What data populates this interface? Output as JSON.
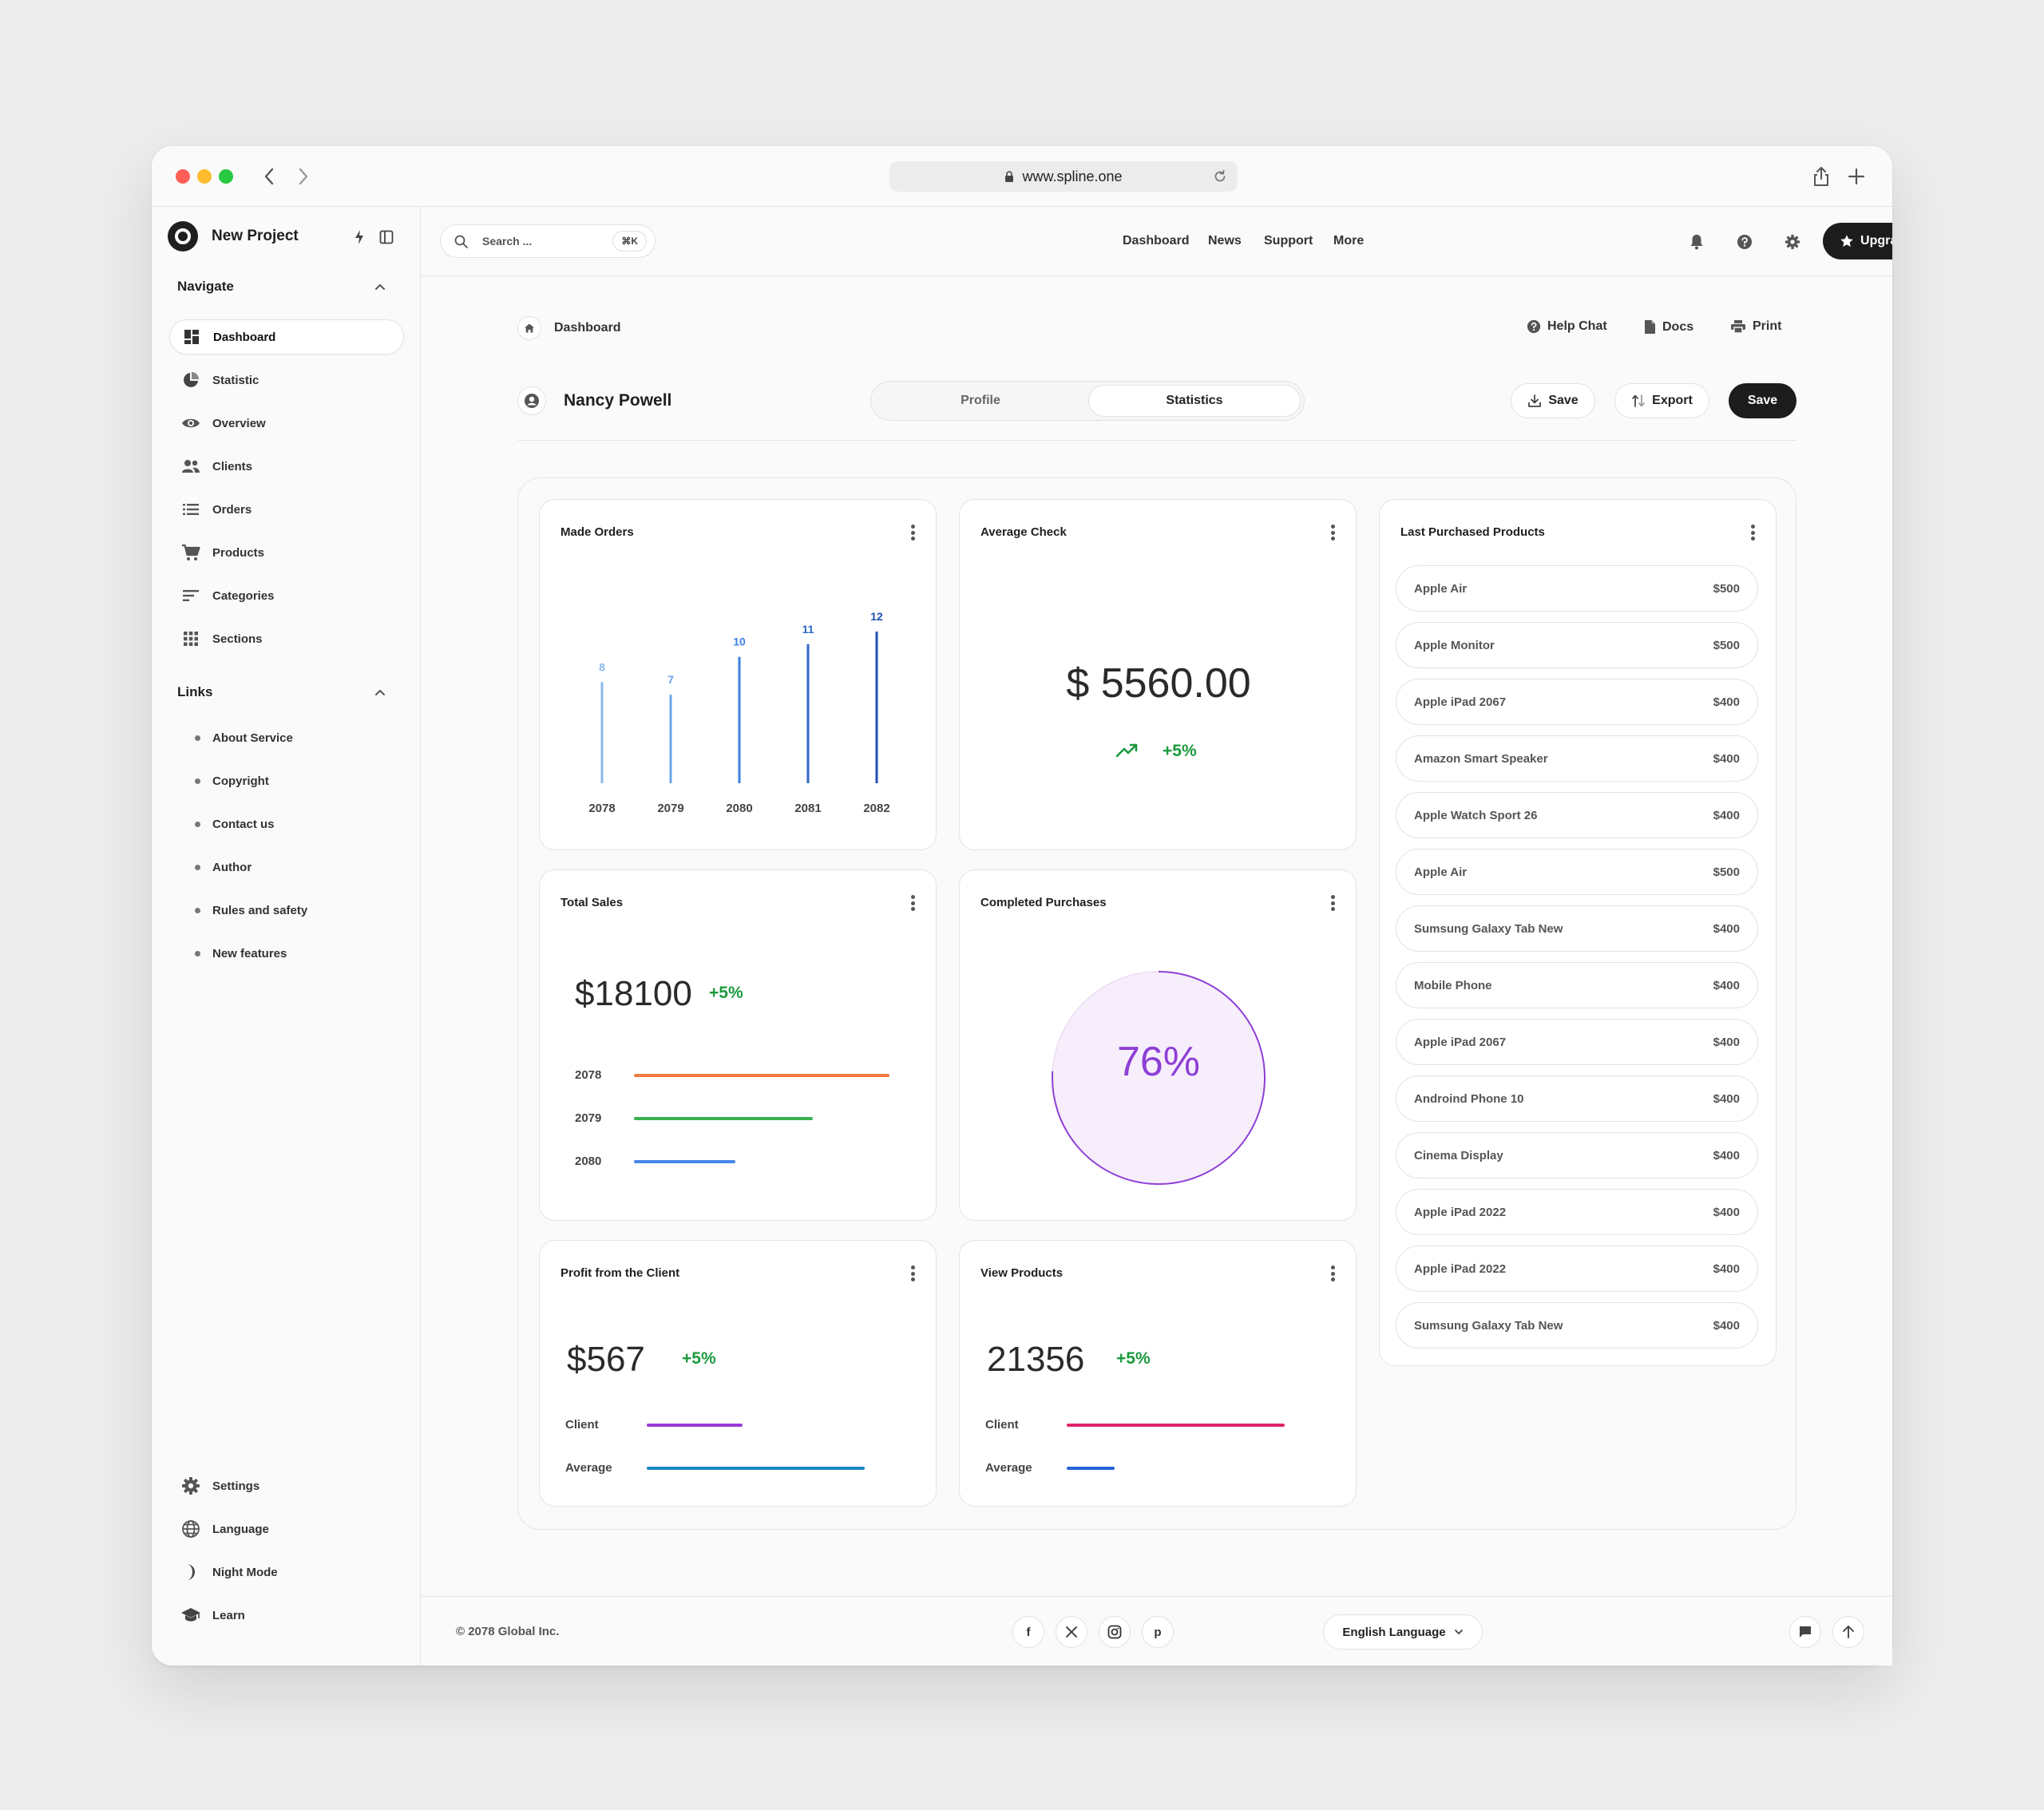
{
  "browser": {
    "url": "www.spline.one",
    "traffic_colors": [
      "#ff5f57",
      "#febc2e",
      "#28c840"
    ]
  },
  "sidebar": {
    "project_name": "New Project",
    "navigate_title": "Navigate",
    "nav_items": [
      {
        "label": "Dashboard",
        "icon": "dashboard-icon",
        "active": true
      },
      {
        "label": "Statistic",
        "icon": "pie-chart-icon"
      },
      {
        "label": "Overview",
        "icon": "eye-icon"
      },
      {
        "label": "Clients",
        "icon": "users-icon"
      },
      {
        "label": "Orders",
        "icon": "list-icon"
      },
      {
        "label": "Products",
        "icon": "cart-icon"
      },
      {
        "label": "Categories",
        "icon": "sort-icon"
      },
      {
        "label": "Sections",
        "icon": "grid-icon"
      }
    ],
    "links_title": "Links",
    "links": [
      "About Service",
      "Copyright",
      "Contact us",
      "Author",
      "Rules and safety",
      "New features"
    ],
    "bottom_items": [
      {
        "label": "Settings",
        "icon": "gear-icon"
      },
      {
        "label": "Language",
        "icon": "globe-icon"
      },
      {
        "label": "Night Mode",
        "icon": "moon-icon"
      },
      {
        "label": "Learn",
        "icon": "graduation-cap-icon"
      }
    ]
  },
  "header": {
    "search_placeholder": "Search ...",
    "search_shortcut": "⌘K",
    "nav": [
      "Dashboard",
      "News",
      "Support",
      "More"
    ],
    "upgrade_label": "Upgrade"
  },
  "breadcrumb": {
    "current": "Dashboard"
  },
  "utility_links": [
    "Help Chat",
    "Docs",
    "Print"
  ],
  "profile": {
    "name": "Nancy Powell",
    "tabs": [
      {
        "label": "Profile"
      },
      {
        "label": "Statistics",
        "active": true
      }
    ],
    "save_outline_label": "Save",
    "export_label": "Export",
    "save_label": "Save"
  },
  "cards": {
    "made_orders": {
      "title": "Made Orders"
    },
    "average_check": {
      "title": "Average Check",
      "value": "$ 5560.00",
      "delta": "+5%"
    },
    "total_sales": {
      "title": "Total Sales",
      "value": "$18100",
      "delta": "+5%",
      "rows": [
        {
          "label": "2078",
          "level": 0.93,
          "color": "#f07a3f"
        },
        {
          "label": "2079",
          "level": 0.65,
          "color": "#38b04f"
        },
        {
          "label": "2080",
          "level": 0.37,
          "color": "#4a86e8"
        }
      ]
    },
    "completed_purchases": {
      "title": "Completed Purchases",
      "value": "76%",
      "percent": 76,
      "color": "#8e3fd6"
    },
    "profit_client": {
      "title": "Profit from the Client",
      "value": "$567",
      "delta": "+5%",
      "rows": [
        {
          "label": "Client",
          "level": 0.34,
          "color": "#9a3ad8"
        },
        {
          "label": "Average",
          "level": 0.77,
          "color": "#1c86c8"
        }
      ]
    },
    "view_products": {
      "title": "View Products",
      "value": "21356",
      "delta": "+5%",
      "rows": [
        {
          "label": "Client",
          "level": 0.77,
          "color": "#e0246a"
        },
        {
          "label": "Average",
          "level": 0.17,
          "color": "#2563d6"
        }
      ]
    },
    "last_products": {
      "title": "Last Purchased Products",
      "items": [
        {
          "name": "Apple Air",
          "price": "$500"
        },
        {
          "name": "Apple Monitor",
          "price": "$500"
        },
        {
          "name": "Apple iPad 2067",
          "price": "$400"
        },
        {
          "name": "Amazon Smart Speaker",
          "price": "$400"
        },
        {
          "name": "Apple Watch Sport 26",
          "price": "$400"
        },
        {
          "name": "Apple Air",
          "price": "$500"
        },
        {
          "name": "Sumsung Galaxy Tab New",
          "price": "$400"
        },
        {
          "name": "Mobile Phone",
          "price": "$400"
        },
        {
          "name": "Apple iPad 2067",
          "price": "$400"
        },
        {
          "name": "Androind Phone 10",
          "price": "$400"
        },
        {
          "name": "Cinema Display",
          "price": "$400"
        },
        {
          "name": "Apple iPad 2022",
          "price": "$400"
        },
        {
          "name": "Apple iPad 2022",
          "price": "$400"
        },
        {
          "name": "Sumsung Galaxy Tab New",
          "price": "$400"
        }
      ]
    }
  },
  "chart_data": {
    "type": "bar",
    "title": "Made Orders",
    "categories": [
      "2078",
      "2079",
      "2080",
      "2081",
      "2082"
    ],
    "values": [
      8,
      7,
      10,
      11,
      12
    ],
    "colors": [
      "#8ab8ef",
      "#6aa4ea",
      "#3d7fde",
      "#2f66c9",
      "#1f4fb5"
    ],
    "ylim": [
      0,
      12
    ],
    "grid": false
  },
  "footer": {
    "copyright": "© 2078 Global Inc.",
    "social": [
      {
        "icon": "facebook-icon",
        "glyph": "f"
      },
      {
        "icon": "x-icon",
        "glyph": "𝕏"
      },
      {
        "icon": "instagram-icon",
        "glyph": ""
      },
      {
        "icon": "pinterest-icon",
        "glyph": "p"
      }
    ],
    "language": "English Language"
  }
}
